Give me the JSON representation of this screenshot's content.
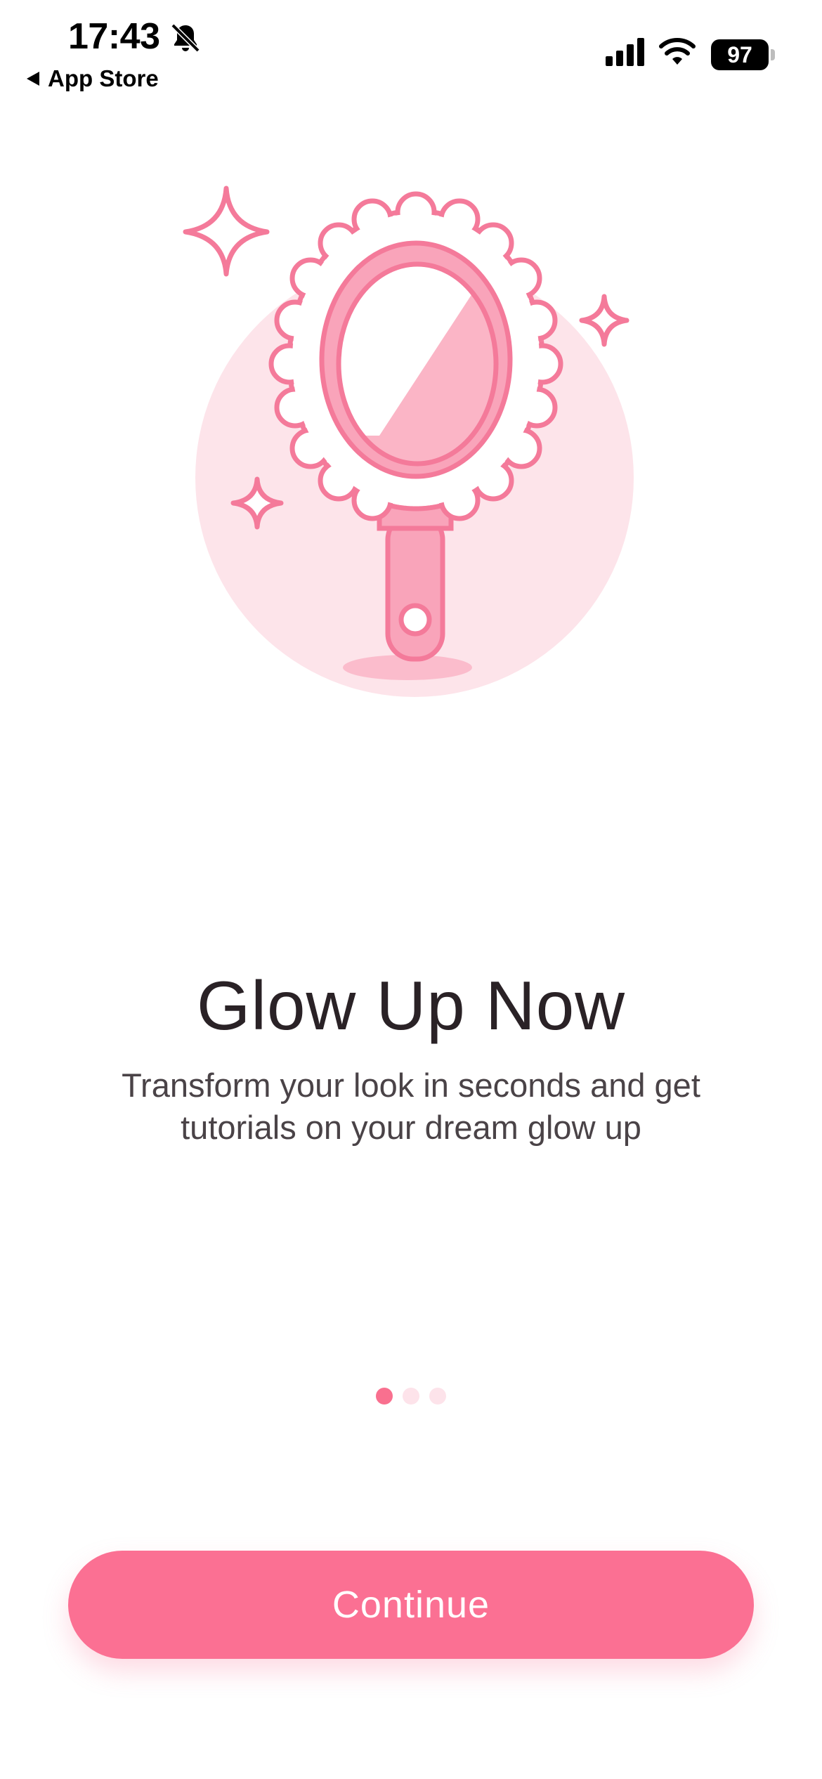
{
  "status_bar": {
    "time": "17:43",
    "back_label": "App Store",
    "battery": "97",
    "icons": [
      "bell-slash-icon",
      "cellular-signal-icon",
      "wifi-icon",
      "battery-icon"
    ]
  },
  "onboarding": {
    "illustration": "hand-mirror-illustration",
    "title": "Glow Up Now",
    "subtitle_line1": "Transform your look in seconds and get",
    "subtitle_line2": "tutorials on your dream glow up",
    "page_count": 3,
    "current_page": 1
  },
  "actions": {
    "continue_label": "Continue"
  },
  "colors": {
    "accent": "#fb7093",
    "accent_light": "#fde3ea",
    "title_text": "#2a2226",
    "body_text": "#4a4347"
  }
}
